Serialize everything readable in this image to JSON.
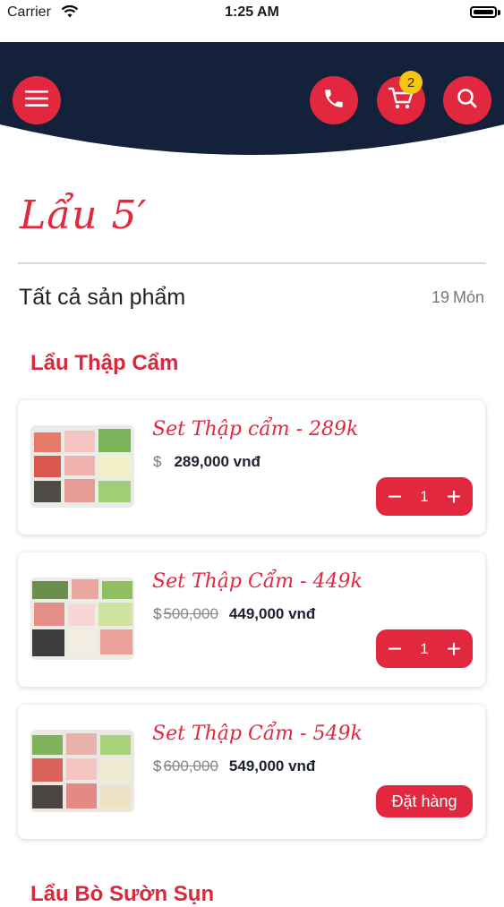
{
  "status_bar": {
    "carrier": "Carrier",
    "time": "1:25 AM"
  },
  "header": {
    "cart_count": "2",
    "icons": [
      "menu-icon",
      "phone-icon",
      "cart-icon",
      "search-icon"
    ],
    "colors": {
      "navy": "#14213a",
      "accent": "#e2283f",
      "badge": "#f5c518"
    }
  },
  "store": {
    "name": "Lẩu 5′"
  },
  "catalog": {
    "heading": "Tất cả sản phẩm",
    "count_number": "19",
    "count_unit": "Món"
  },
  "sections": [
    {
      "title": "Lẩu Thập Cẩm",
      "items": [
        {
          "name": "Set Thập cẩm - 289k",
          "currency": "$",
          "old_price": "",
          "price": "289,000 vnđ",
          "qty": "1",
          "minus": "−",
          "plus": "+"
        },
        {
          "name": "Set Thập Cẩm - 449k",
          "currency": "$",
          "old_price": "500,000",
          "price": "449,000 vnđ",
          "qty": "1",
          "minus": "−",
          "plus": "+"
        },
        {
          "name": "Set Thập Cẩm - 549k",
          "currency": "$",
          "old_price": "600,000",
          "price": "549,000 vnđ",
          "order_label": "Đặt hàng"
        }
      ]
    },
    {
      "title": "Lẩu Bò Sườn Sụn"
    }
  ]
}
